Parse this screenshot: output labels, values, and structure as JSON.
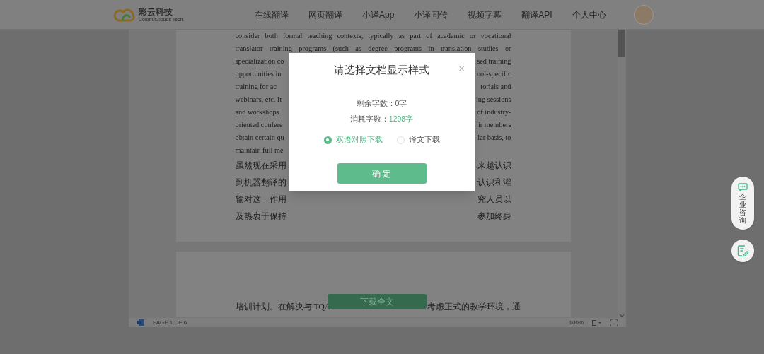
{
  "header": {
    "logo": {
      "name": "彩云科技",
      "tagline": "ColorfulClouds Tech."
    },
    "nav": [
      "在线翻译",
      "网页翻译",
      "小译App",
      "小译同传",
      "视频字幕",
      "翻译API",
      "个人中心"
    ]
  },
  "document": {
    "pages": [
      {
        "lines": [
          {
            "kind": "en_full",
            "text": "consider both formal teaching contexts, typically as part of academic or vocational"
          },
          {
            "kind": "en_full",
            "text": "translator training programs (such as degree programs in translation studies or"
          },
          {
            "kind": "en_split",
            "left": "specialization co",
            "right": "sed training"
          },
          {
            "kind": "en_split",
            "left": "opportunities in",
            "right": "ool-specific"
          },
          {
            "kind": "en_split",
            "left": "training for ac",
            "right": "torials and"
          },
          {
            "kind": "en_split",
            "left": "webinars, etc. It",
            "right": "ing sessions"
          },
          {
            "kind": "en_split",
            "left": "and workshops",
            "right": "of industry-"
          },
          {
            "kind": "en_split",
            "left": "oriented confere",
            "right": "ir members"
          },
          {
            "kind": "en_split",
            "left": "obtain certain qu",
            "right": "lar basis, to"
          },
          {
            "kind": "en_split",
            "left": "maintain full me"
          },
          {
            "kind": "zh_split",
            "left": "虽然现在采用",
            "right": "来越认识"
          },
          {
            "kind": "zh_split",
            "left": "到机器翻译的",
            "right": "认识和灌"
          },
          {
            "kind": "zh_split",
            "left": "输对这一作用",
            "right": "究人员以"
          },
          {
            "kind": "zh_split",
            "left": "及热衷于保持",
            "right": "参加终身"
          }
        ]
      },
      {
        "lines": [
          {
            "kind": "zh_split_wide",
            "left": "培训计划。在解决与 TQA",
            "right": "考虑正式的教学环境，通"
          }
        ]
      }
    ],
    "download_button": "下载全文",
    "status_bar": {
      "page": "PAGE 1 OF 6",
      "zoom": "100%"
    }
  },
  "side_widgets": {
    "consult": "企业咨询"
  },
  "dialog": {
    "title": "请选择文档显示样式",
    "close": "×",
    "remaining": {
      "label": "剩余字数：",
      "value": "0字"
    },
    "consumed": {
      "label": "消耗字数：",
      "value": "1298字"
    },
    "options": [
      {
        "label": "双语对照下载",
        "selected": true
      },
      {
        "label": "译文下载",
        "selected": false
      }
    ],
    "confirm": "确 定"
  }
}
